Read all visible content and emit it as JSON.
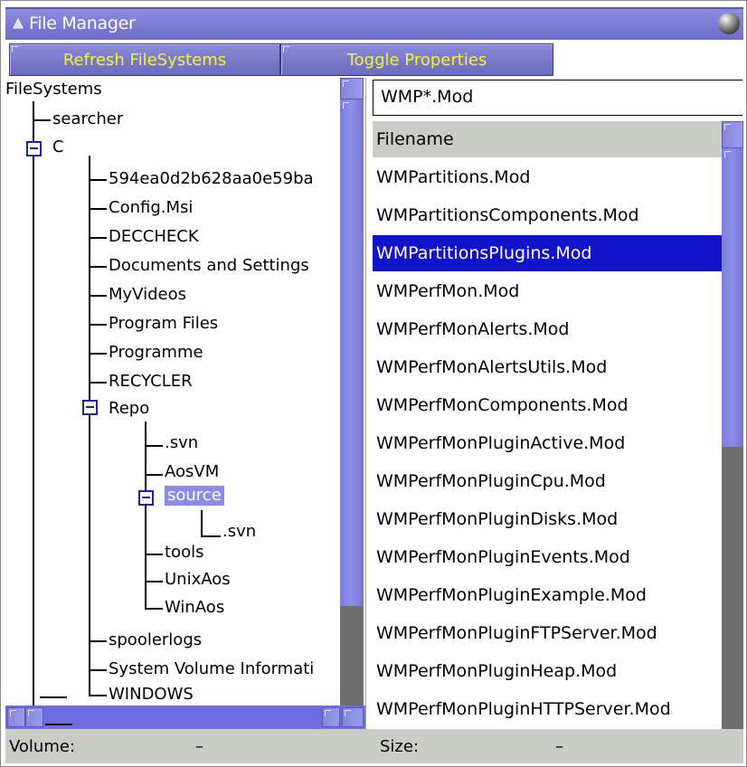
{
  "window": {
    "title": "File Manager"
  },
  "toolbar": {
    "refresh_label": "Refresh FileSystems",
    "toggle_label": "Toggle Properties"
  },
  "tree": {
    "root": "FileSystems",
    "searcher": "searcher",
    "c": "C",
    "c_children": [
      "594ea0d2b628aa0e59ba",
      "Config.Msi",
      "DECCHECK",
      "Documents and Settings",
      "MyVideos",
      "Program Files",
      "Programme",
      "RECYCLER"
    ],
    "repo": "Repo",
    "repo_children": [
      ".svn",
      "AosVM"
    ],
    "source": "source",
    "source_svn": ".svn",
    "repo_children_after": [
      "tools",
      "UnixAos",
      "WinAos"
    ],
    "c_children_after": [
      "spoolerlogs",
      "System Volume Informati",
      "WINDOWS"
    ]
  },
  "filter": {
    "value": "WMP*.Mod"
  },
  "filelist": {
    "column_header": "Filename",
    "rows": [
      "WMPartitions.Mod",
      "WMPartitionsComponents.Mod",
      "WMPartitionsPlugins.Mod",
      "WMPerfMon.Mod",
      "WMPerfMonAlerts.Mod",
      "WMPerfMonAlertsUtils.Mod",
      "WMPerfMonComponents.Mod",
      "WMPerfMonPluginActive.Mod",
      "WMPerfMonPluginCpu.Mod",
      "WMPerfMonPluginDisks.Mod",
      "WMPerfMonPluginEvents.Mod",
      "WMPerfMonPluginExample.Mod",
      "WMPerfMonPluginFTPServer.Mod",
      "WMPerfMonPluginHeap.Mod",
      "WMPerfMonPluginHTTPServer.Mod"
    ],
    "selected_index": 2
  },
  "status": {
    "volume_label": "Volume:",
    "volume_value": "–",
    "size_label": "Size:",
    "size_value": "–"
  },
  "colors": {
    "accent": "#7676d6",
    "selection": "#1212c8",
    "button_text": "#f5f52a",
    "status_bg": "#c9cdc6"
  },
  "icons": {
    "title": "window-icon",
    "close": "close-orb-icon"
  }
}
